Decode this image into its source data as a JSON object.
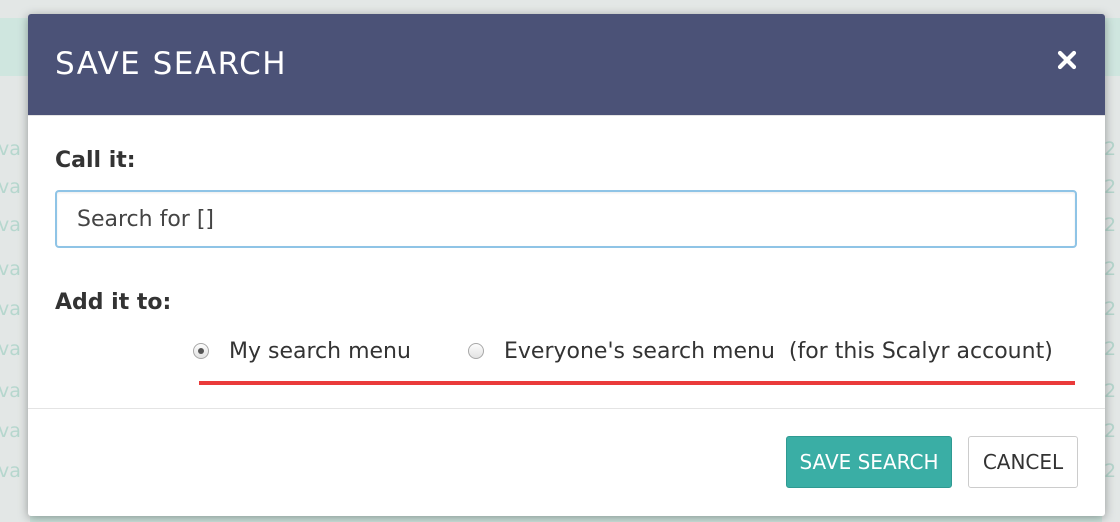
{
  "dialog": {
    "title": "SAVE SEARCH",
    "close_icon": "close-icon"
  },
  "form": {
    "name_label": "Call it:",
    "name_value": "Search for []",
    "destination_label": "Add it to:",
    "options": [
      {
        "label": "My search menu",
        "selected": true
      },
      {
        "label": "Everyone's search menu  (for this Scalyr account)",
        "selected": false
      }
    ]
  },
  "footer": {
    "save_label": "SAVE SEARCH",
    "cancel_label": "CANCEL"
  },
  "colors": {
    "header_bg": "#4b5277",
    "primary_button": "#3aaea5",
    "annotation_underline": "#ea3a3a",
    "input_focus_border": "#8fc4e6"
  }
}
